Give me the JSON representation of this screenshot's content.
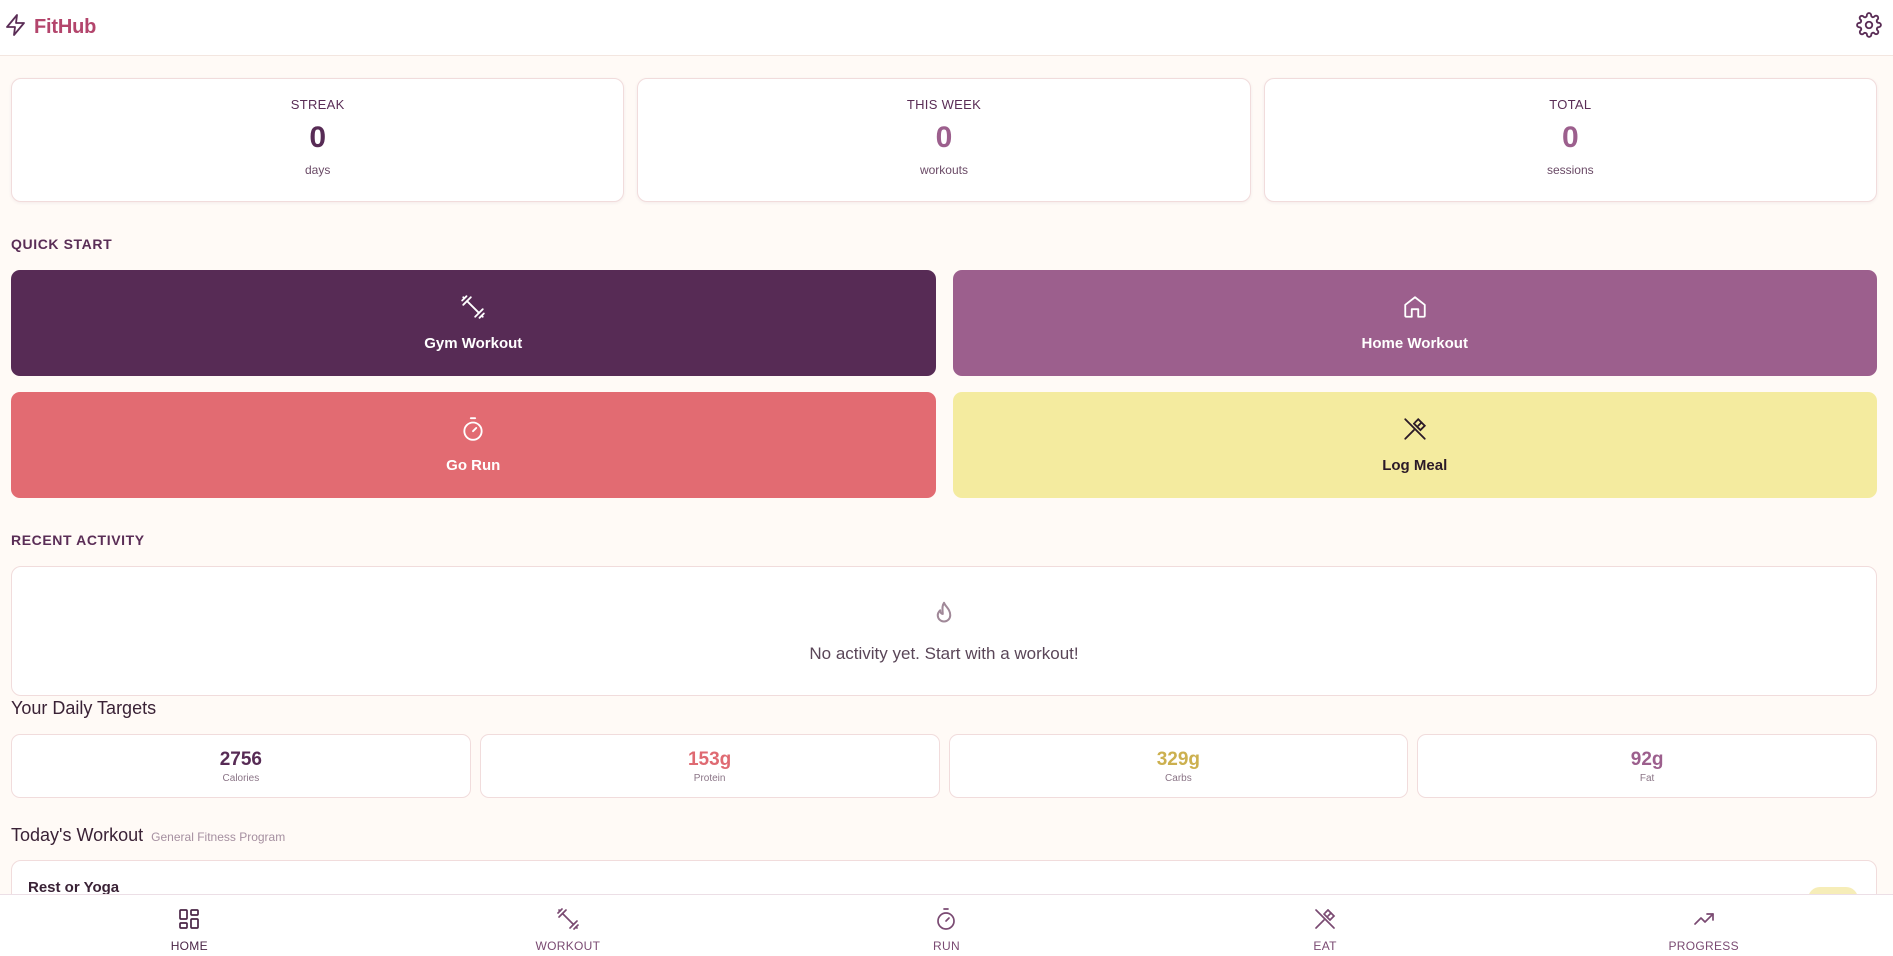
{
  "app": {
    "name": "FitHub"
  },
  "colors": {
    "brand": "#b3456c",
    "gym": "#572b55",
    "home": "#9c5f8d",
    "run": "#e26b72",
    "meal": "#f4eb9f",
    "protein": "#df6a72",
    "carbs": "#ccb04f",
    "fat": "#9c5f8d"
  },
  "icons": {
    "brand": "lightning-icon",
    "settings": "gear-icon",
    "gym": "dumbbell-icon",
    "home": "house-icon",
    "run": "stopwatch-icon",
    "meal": "utensils-icon",
    "activity": "flame-icon"
  },
  "stats": [
    {
      "label": "STREAK",
      "value": "0",
      "unit": "days"
    },
    {
      "label": "THIS WEEK",
      "value": "0",
      "unit": "workouts"
    },
    {
      "label": "TOTAL",
      "value": "0",
      "unit": "sessions"
    }
  ],
  "quick_start": {
    "title": "QUICK START",
    "buttons": [
      {
        "label": "Gym Workout"
      },
      {
        "label": "Home Workout"
      },
      {
        "label": "Go Run"
      },
      {
        "label": "Log Meal"
      }
    ]
  },
  "recent_activity": {
    "title": "RECENT ACTIVITY",
    "empty_text": "No activity yet. Start with a workout!"
  },
  "daily_targets": {
    "title": "Your Daily Targets",
    "items": [
      {
        "value": "2756",
        "label": "Calories"
      },
      {
        "value": "153g",
        "label": "Protein"
      },
      {
        "value": "329g",
        "label": "Carbs"
      },
      {
        "value": "92g",
        "label": "Fat"
      }
    ]
  },
  "todays_workout": {
    "title": "Today's Workout",
    "program": "General Fitness Program",
    "name": "Rest or Yoga"
  },
  "nav": [
    {
      "label": "HOME"
    },
    {
      "label": "WORKOUT"
    },
    {
      "label": "RUN"
    },
    {
      "label": "EAT"
    },
    {
      "label": "PROGRESS"
    }
  ]
}
